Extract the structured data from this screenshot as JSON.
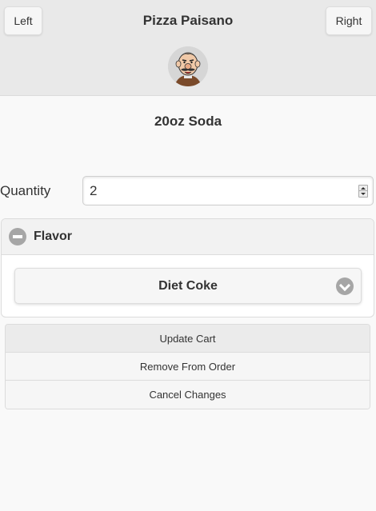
{
  "header": {
    "left_button": "Left",
    "title": "Pizza Paisano",
    "right_button": "Right",
    "logo_icon": "chef-caricature-logo"
  },
  "item": {
    "title": "20oz Soda"
  },
  "quantity": {
    "label": "Quantity",
    "value": "2"
  },
  "flavor": {
    "heading": "Flavor",
    "selected": "Diet Coke",
    "expanded": true
  },
  "actions": {
    "update": "Update Cart",
    "remove": "Remove From Order",
    "cancel": "Cancel Changes"
  },
  "colors": {
    "header_bg": "#e9e9e9",
    "page_bg": "#f9f9f9",
    "icon_gray": "#a6a6a6"
  }
}
